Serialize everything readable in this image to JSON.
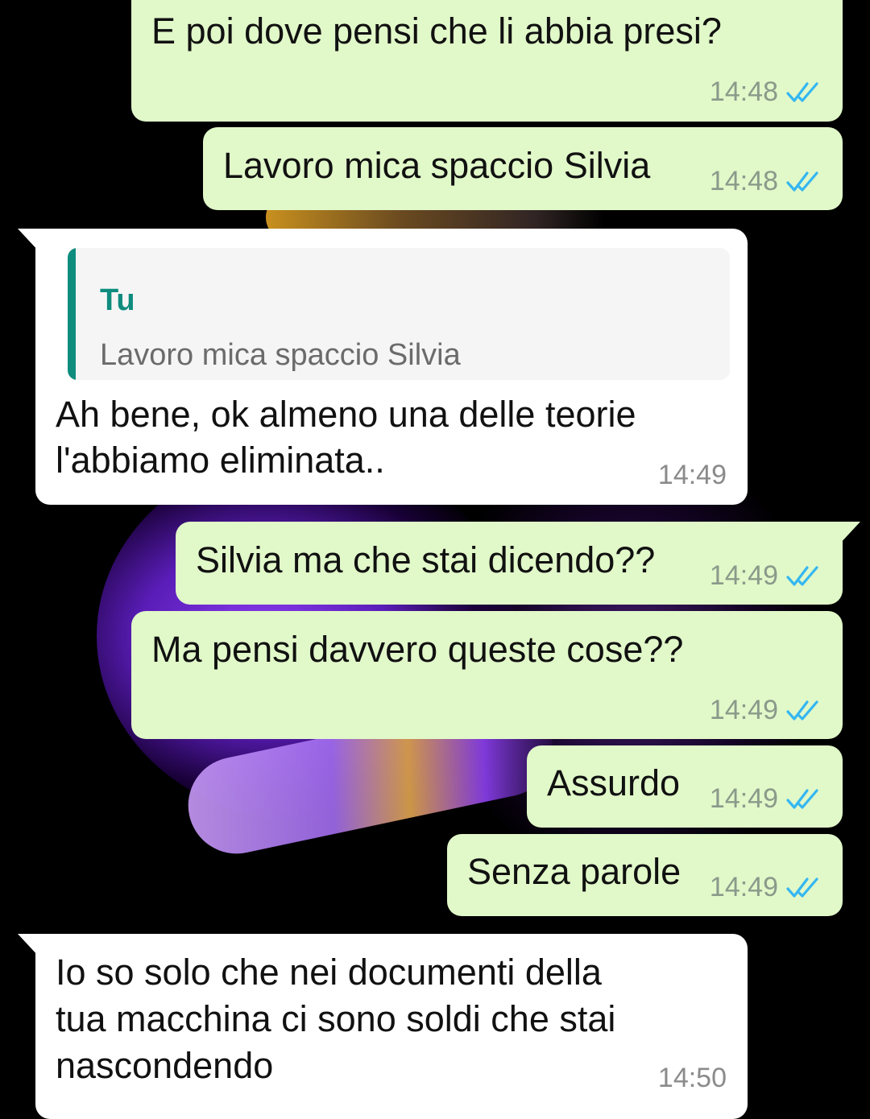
{
  "messages": [
    {
      "id": "m1",
      "text": "E poi dove pensi che li abbia presi?",
      "time": "14:48",
      "status_icon": "double-check-icon"
    },
    {
      "id": "m2",
      "text": "Lavoro mica spaccio Silvia",
      "time": "14:48",
      "status_icon": "double-check-icon"
    },
    {
      "id": "m3",
      "quote": {
        "sender": "Tu",
        "text": "Lavoro mica spaccio Silvia"
      },
      "lines": [
        "Ah bene, ok almeno una delle teorie",
        "l'abbiamo eliminata.."
      ],
      "time": "14:49"
    },
    {
      "id": "m4",
      "text": "Silvia ma che stai dicendo??",
      "time": "14:49",
      "status_icon": "double-check-icon"
    },
    {
      "id": "m5",
      "text": "Ma pensi davvero queste cose??",
      "time": "14:49",
      "status_icon": "double-check-icon"
    },
    {
      "id": "m6",
      "text": "Assurdo",
      "time": "14:49",
      "status_icon": "double-check-icon"
    },
    {
      "id": "m7",
      "text": "Senza parole",
      "time": "14:49",
      "status_icon": "double-check-icon"
    },
    {
      "id": "m8",
      "lines": [
        "Io so solo che nei documenti della",
        "tua macchina ci sono soldi che stai",
        "nascondendo"
      ],
      "time": "14:50"
    }
  ],
  "colors": {
    "outgoing_bubble": "#e1f8c9",
    "incoming_bubble": "#ffffff",
    "quote_accent": "#0e8c7e",
    "read_check": "#34b7f1"
  }
}
